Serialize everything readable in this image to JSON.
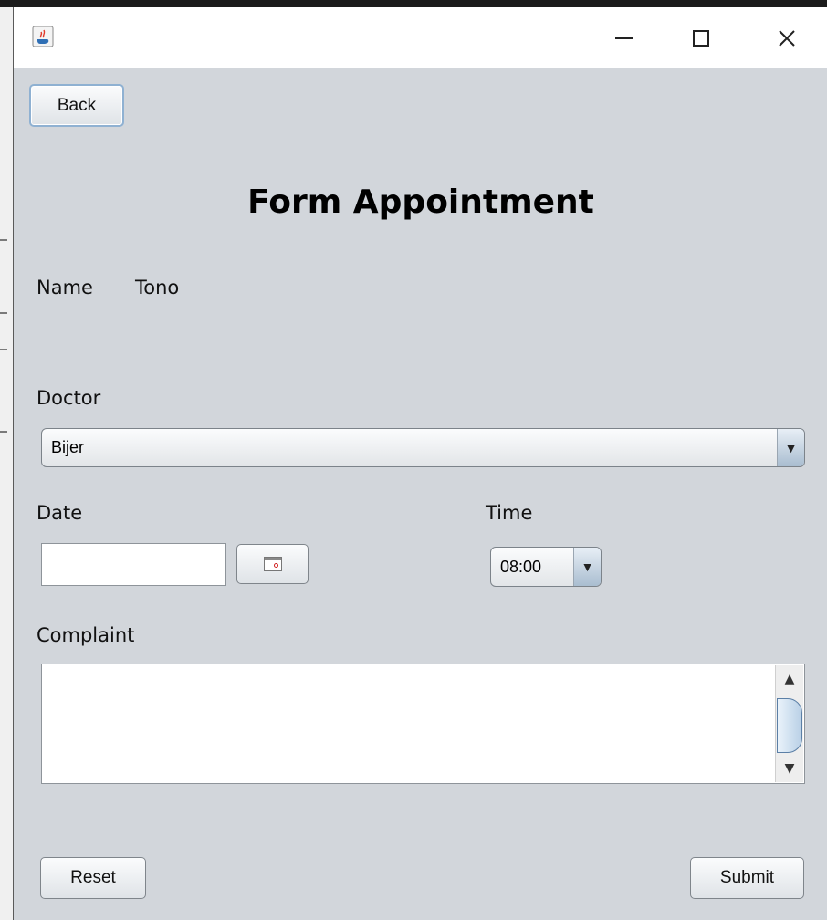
{
  "window": {
    "app_icon": "java-coffee-icon",
    "controls": {
      "minimize_icon": "minimize-icon",
      "maximize_icon": "maximize-icon",
      "close_icon": "close-icon",
      "close_glyph": "✕"
    }
  },
  "toolbar": {
    "back_label": "Back"
  },
  "form": {
    "title": "Form Appointment",
    "name_label": "Name",
    "name_value": "Tono",
    "doctor_label": "Doctor",
    "doctor_selected": "Bijer",
    "date_label": "Date",
    "date_value": "",
    "calendar_icon": "calendar-icon",
    "time_label": "Time",
    "time_selected": "08:00",
    "complaint_label": "Complaint",
    "complaint_value": "",
    "dropdown_glyph": "▼",
    "scroll_up_glyph": "▲",
    "scroll_down_glyph": "▼"
  },
  "actions": {
    "reset_label": "Reset",
    "submit_label": "Submit"
  },
  "colors": {
    "window_bg": "#d2d6db",
    "titlebar_bg": "#ffffff",
    "button_gradient_top": "#fbfcfd",
    "button_gradient_bottom": "#dfe3e7",
    "combo_arrow_bg": "#a9bdd0",
    "focus_border": "#8fb1d2"
  }
}
